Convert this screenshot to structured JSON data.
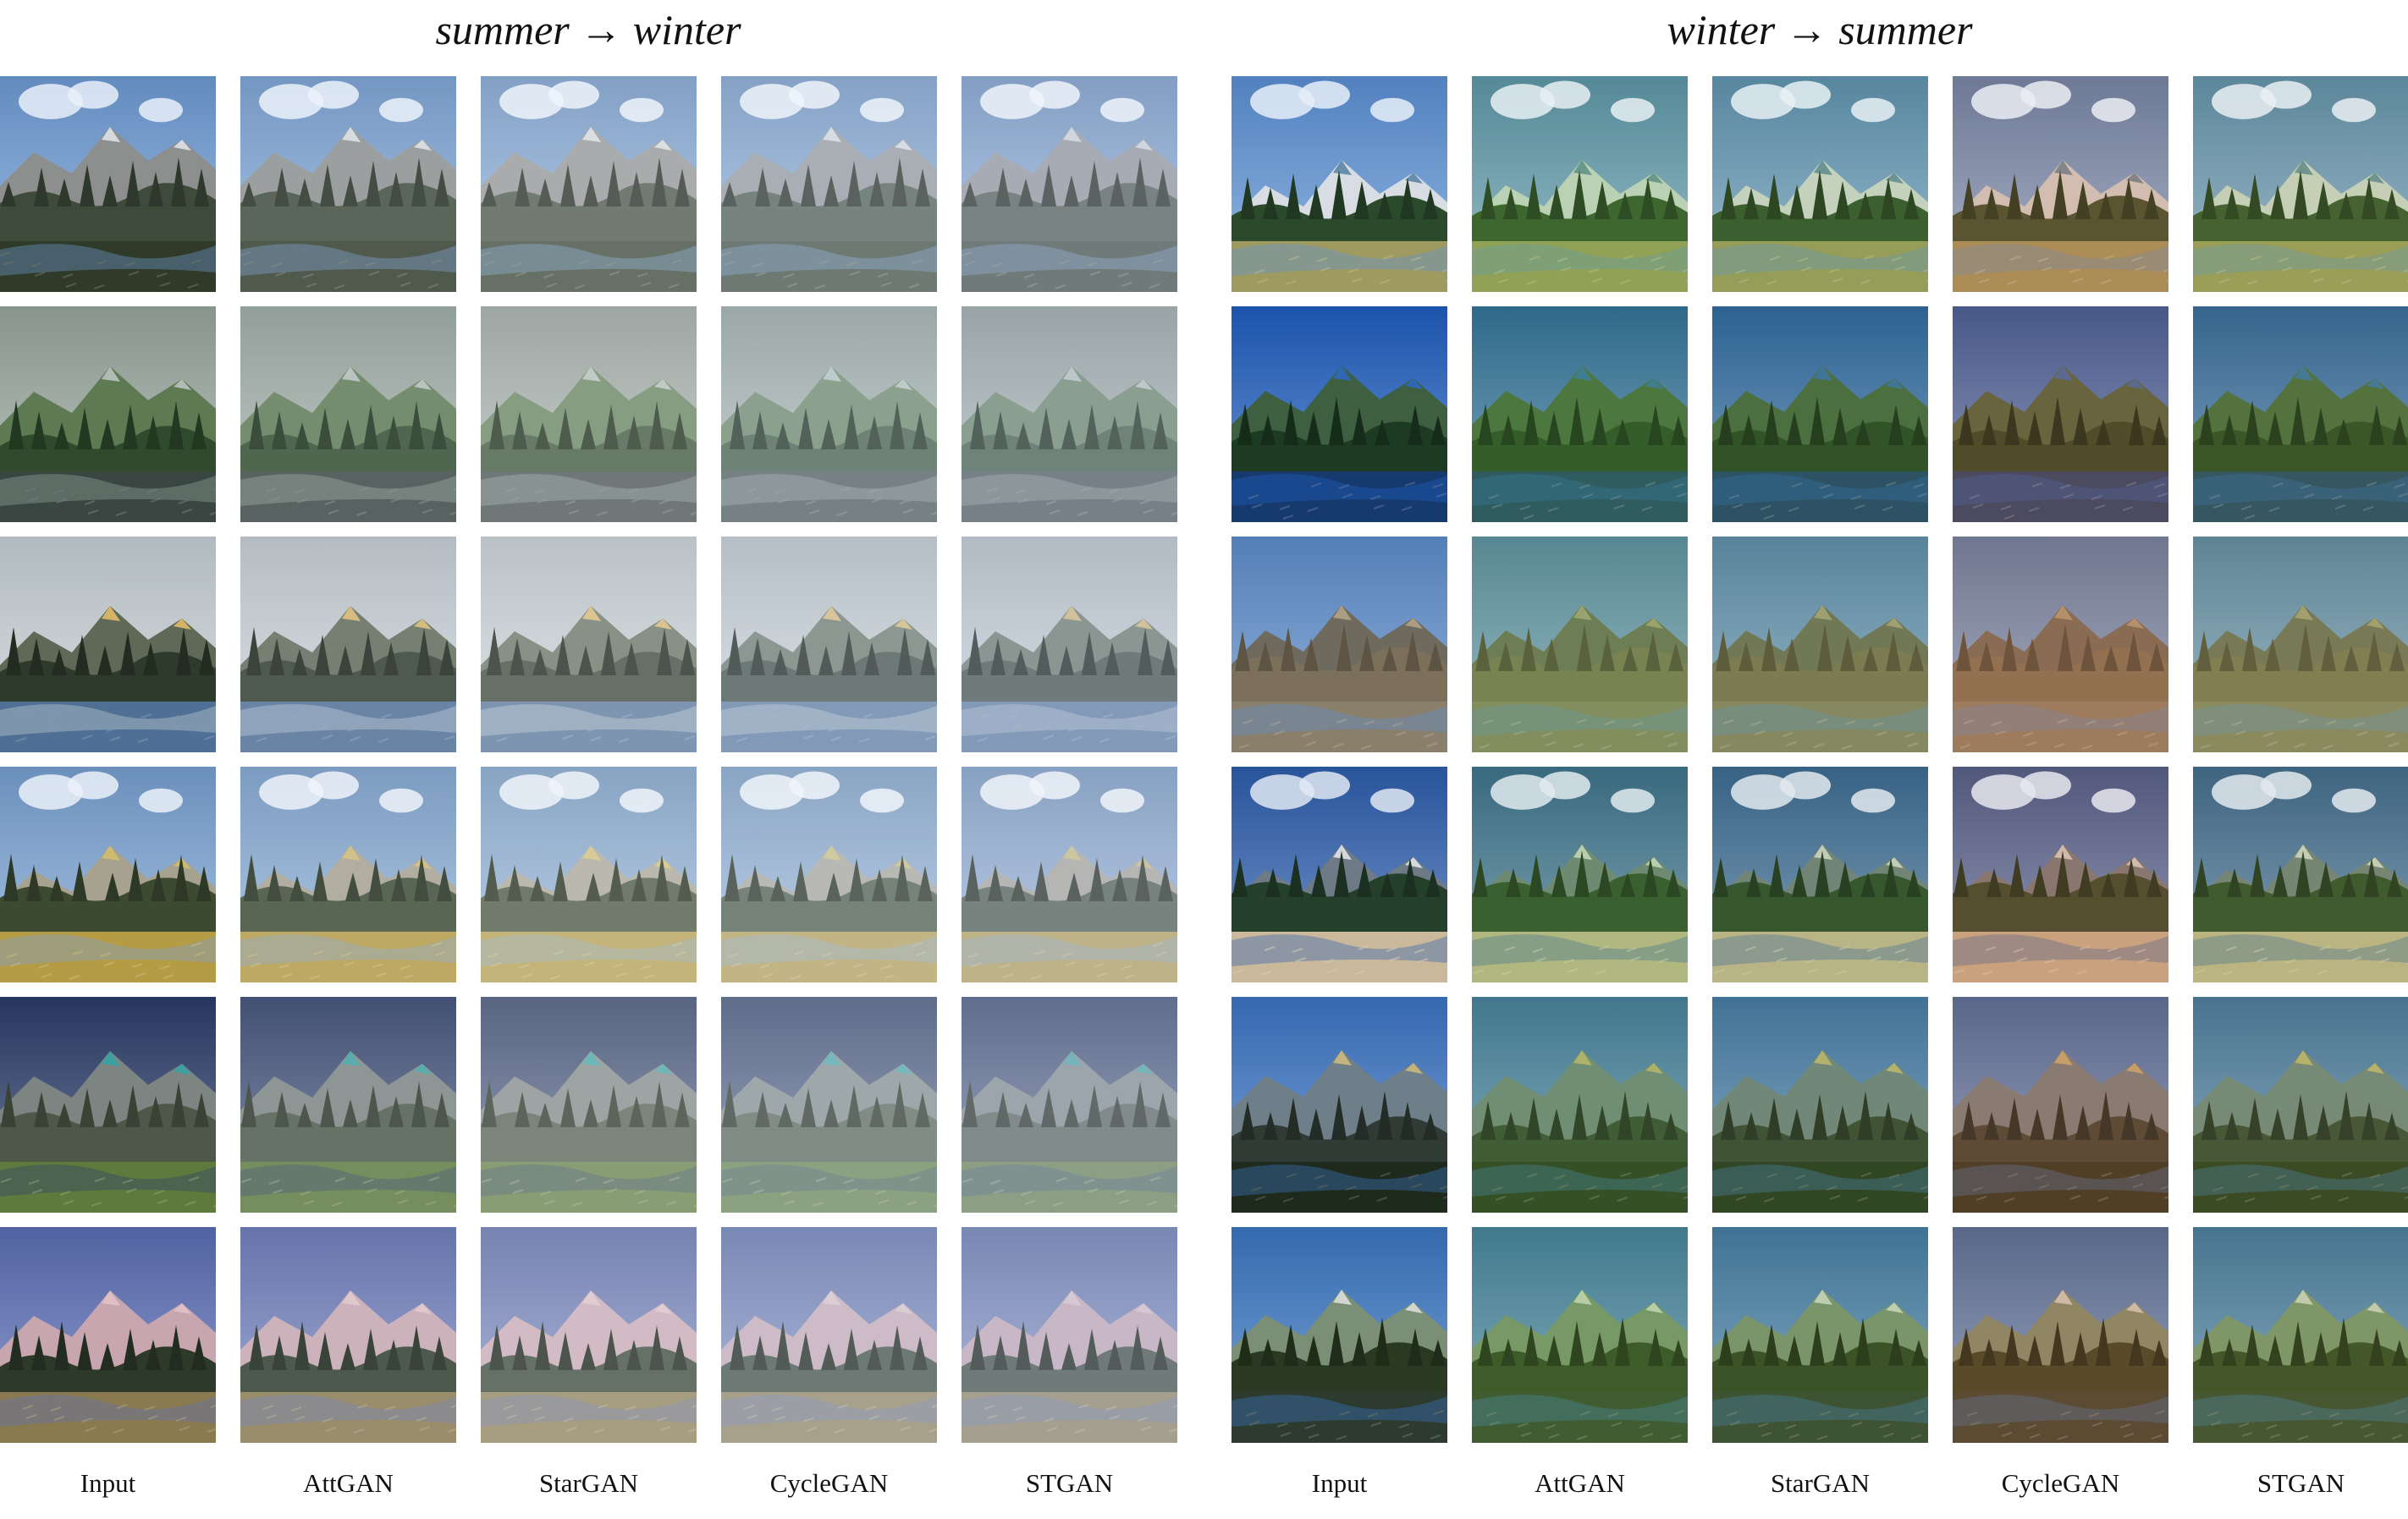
{
  "groups": [
    {
      "title": "summer → winter",
      "columns": [
        "Input",
        "AttGAN",
        "StarGAN",
        "CycleGAN",
        "STGAN"
      ],
      "rows": [
        {
          "scene": "waterfall-cliff",
          "palette": {
            "sky": "#6f9ed8",
            "far": "#8d8f8f",
            "mid": "#3e4a3a",
            "ground": "#2f3a28",
            "accent": "#e8ecef"
          }
        },
        {
          "scene": "forest-lake",
          "palette": {
            "sky": "#9aa9a0",
            "far": "#5d7a52",
            "mid": "#2f4a2c",
            "ground": "#3a4642",
            "accent": "#c7ccd0"
          }
        },
        {
          "scene": "sunset-river",
          "palette": {
            "sky": "#c9d3d8",
            "far": "#5e6a57",
            "mid": "#2e3a2c",
            "ground": "#4f6f95",
            "accent": "#f3c56a"
          }
        },
        {
          "scene": "meadow-stream",
          "palette": {
            "sky": "#7aa4d6",
            "far": "#a7a190",
            "mid": "#3c4a32",
            "ground": "#b69b45",
            "accent": "#d8c26a"
          }
        },
        {
          "scene": "valley-grassland",
          "palette": {
            "sky": "#2b3d6b",
            "far": "#7c8582",
            "mid": "#4d5848",
            "ground": "#5f7a3d",
            "accent": "#2aa6a6"
          }
        },
        {
          "scene": "mountain-lake-dusk",
          "palette": {
            "sky": "#5c6fb8",
            "far": "#c8a6b0",
            "mid": "#2d3a2a",
            "ground": "#8a7a50",
            "accent": "#e3c7c9"
          }
        }
      ]
    },
    {
      "title": "winter → summer",
      "columns": [
        "Input",
        "AttGAN",
        "StarGAN",
        "CycleGAN",
        "STGAN"
      ],
      "rows": [
        {
          "scene": "alpine-pond",
          "palette": {
            "sky": "#5c93d8",
            "far": "#d7dde2",
            "mid": "#2b4a2c",
            "ground": "#9e9a60",
            "accent": "#4c7aa0"
          }
        },
        {
          "scene": "lake-reflection",
          "palette": {
            "sky": "#1f5fc2",
            "far": "#3e5f40",
            "mid": "#1d3b22",
            "ground": "#173a6e",
            "accent": "#2a6ad0"
          }
        },
        {
          "scene": "brush-plain",
          "palette": {
            "sky": "#5e8fd0",
            "far": "#6e6a5e",
            "mid": "#7c705a",
            "ground": "#8a7f6a",
            "accent": "#b9aa8a"
          }
        },
        {
          "scene": "granite-ridge",
          "palette": {
            "sky": "#2e5fb0",
            "far": "#6e7a86",
            "mid": "#24402a",
            "ground": "#c9b89a",
            "accent": "#f0f0f0"
          }
        },
        {
          "scene": "el-capitan-valley",
          "palette": {
            "sky": "#3c76c8",
            "far": "#6f7f8a",
            "mid": "#2f3b34",
            "ground": "#1d2a1c",
            "accent": "#d8c07a"
          }
        },
        {
          "scene": "riverside-trees",
          "palette": {
            "sky": "#3a78c6",
            "far": "#7a8f76",
            "mid": "#2a3a22",
            "ground": "#2c3b2e",
            "accent": "#e6e9e8"
          }
        }
      ]
    }
  ]
}
